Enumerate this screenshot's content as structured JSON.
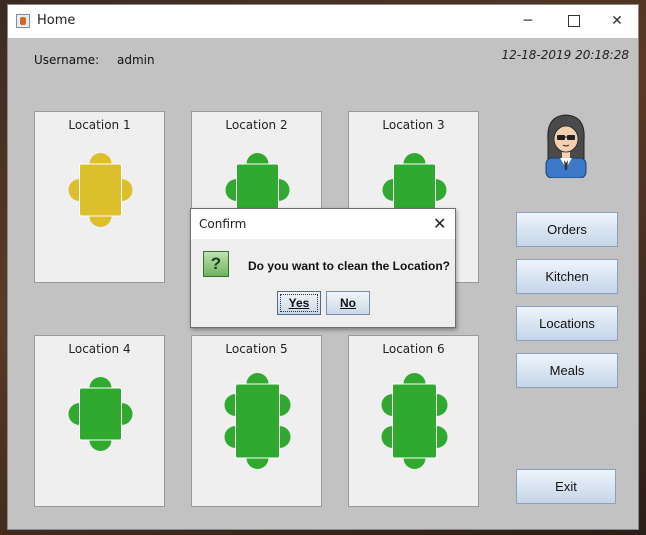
{
  "window": {
    "title": "Home",
    "controls": {
      "minimize": "─",
      "close": "✕"
    }
  },
  "header": {
    "username_label": "Username:",
    "username_value": "admin",
    "datetime": "12-18-2019 20:18:28"
  },
  "locations": [
    {
      "label": "Location 1",
      "status": "occupied",
      "seats": 4,
      "color": "#dcbf2a"
    },
    {
      "label": "Location 2",
      "status": "free",
      "seats": 4,
      "color": "#2faa2f"
    },
    {
      "label": "Location 3",
      "status": "free",
      "seats": 4,
      "color": "#2faa2f"
    },
    {
      "label": "Location 4",
      "status": "free",
      "seats": 4,
      "color": "#2faa2f"
    },
    {
      "label": "Location 5",
      "status": "free",
      "seats": 6,
      "color": "#2faa2f"
    },
    {
      "label": "Location 6",
      "status": "free",
      "seats": 6,
      "color": "#2faa2f"
    }
  ],
  "sidebar": {
    "avatar": "waiter-avatar-icon",
    "buttons": [
      "Orders",
      "Kitchen",
      "Locations",
      "Meals"
    ],
    "exit": "Exit"
  },
  "dialog": {
    "title": "Confirm",
    "close": "✕",
    "icon": "question-icon",
    "icon_glyph": "?",
    "message": "Do you want to clean the Location?",
    "yes": "Yes",
    "no": "No"
  }
}
